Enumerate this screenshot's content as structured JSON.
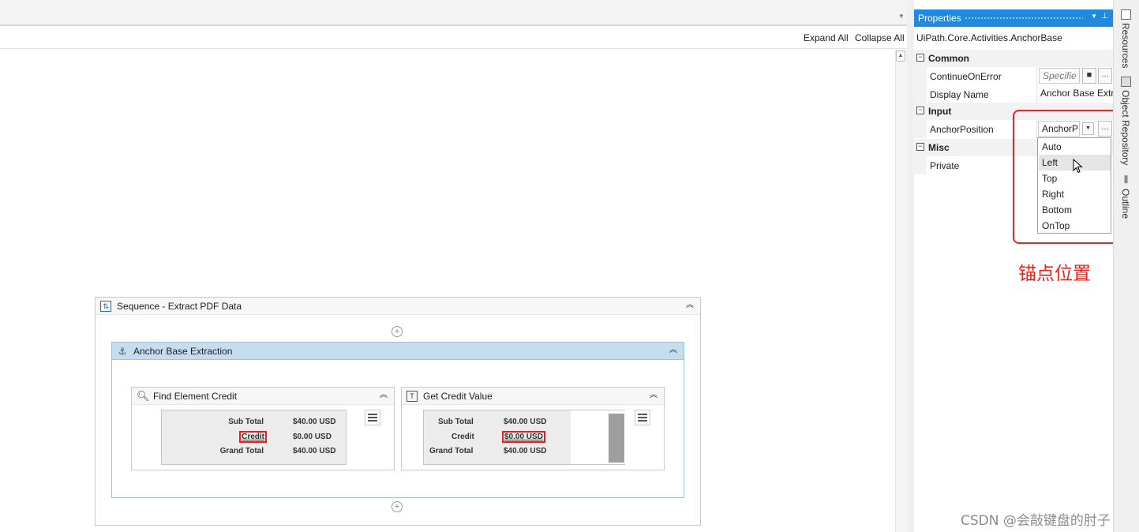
{
  "designer": {
    "expand_all": "Expand All",
    "collapse_all": "Collapse All"
  },
  "sequence": {
    "title": "Sequence - Extract PDF Data"
  },
  "anchor_base": {
    "title": "Anchor Base Extraction"
  },
  "find_element": {
    "title": "Find Element Credit",
    "rows": [
      {
        "label": "Sub Total",
        "value": "$40.00 USD"
      },
      {
        "label": "Credit",
        "value": "$0.00 USD"
      },
      {
        "label": "Grand Total",
        "value": "$40.00 USD"
      }
    ],
    "highlighted": "label of Credit row"
  },
  "get_credit_value": {
    "title": "Get Credit Value",
    "rows": [
      {
        "label": "Sub Total",
        "value": "$40.00 USD"
      },
      {
        "label": "Credit",
        "value": "$0.00 USD"
      },
      {
        "label": "Grand Total",
        "value": "$40.00 USD"
      }
    ],
    "highlighted": "value of Credit row"
  },
  "properties": {
    "title": "Properties",
    "type_name": "UiPath.Core.Activities.AnchorBase",
    "categories": {
      "common": "Common",
      "input": "Input",
      "misc": "Misc"
    },
    "rows": {
      "continue_on_error": {
        "name": "ContinueOnError",
        "placeholder": "Specifies"
      },
      "display_name": {
        "name": "Display Name",
        "value": "Anchor Base Extr"
      },
      "anchor_position": {
        "name": "AnchorPosition",
        "value": "AnchorP"
      },
      "private": {
        "name": "Private"
      }
    },
    "dropdown_options": [
      "Auto",
      "Left",
      "Top",
      "Right",
      "Bottom",
      "OnTop"
    ],
    "hovered_option": "Left"
  },
  "annotation": {
    "text": "锚点位置",
    "color": "#f0201a"
  },
  "side_tabs": [
    "Resources",
    "Object Repository",
    "Outline"
  ],
  "watermark": "CSDN @会敲键盘的肘子",
  "colors": {
    "accent": "#1f8ae0",
    "selected_activity_header": "#c5ddf0",
    "highlight_red": "#e02020"
  }
}
